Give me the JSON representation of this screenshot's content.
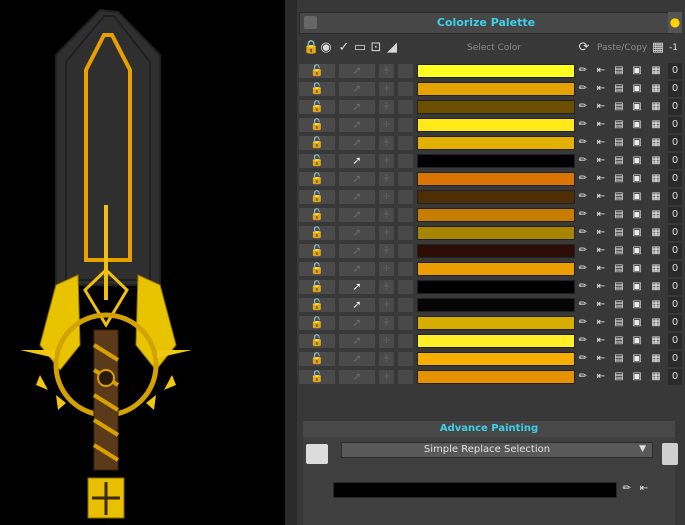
{
  "panel": {
    "title": "Colorize Palette",
    "header": {
      "select_color_label": "Select Color",
      "paste_copy_label": "Paste/Copy",
      "header_number": "-1"
    },
    "rows": [
      {
        "color": "#ffff22",
        "brush_active": false,
        "value": "0"
      },
      {
        "color": "#e4a300",
        "brush_active": false,
        "value": "0"
      },
      {
        "color": "#6b4e00",
        "brush_active": false,
        "value": "0"
      },
      {
        "color": "#ffe918",
        "brush_active": false,
        "value": "0"
      },
      {
        "color": "#e3b000",
        "brush_active": false,
        "value": "0"
      },
      {
        "color": "#000000",
        "brush_active": true,
        "value": "0"
      },
      {
        "color": "#d97500",
        "brush_active": false,
        "value": "0"
      },
      {
        "color": "#4d2e05",
        "brush_active": false,
        "value": "0"
      },
      {
        "color": "#c87d00",
        "brush_active": false,
        "value": "0"
      },
      {
        "color": "#a98400",
        "brush_active": false,
        "value": "0"
      },
      {
        "color": "#2c0d05",
        "brush_active": false,
        "value": "0"
      },
      {
        "color": "#ec9e00",
        "brush_active": false,
        "value": "0"
      },
      {
        "color": "#000000",
        "brush_active": true,
        "value": "0"
      },
      {
        "color": "#050505",
        "brush_active": true,
        "value": "0"
      },
      {
        "color": "#d7ad00",
        "brush_active": false,
        "value": "0"
      },
      {
        "color": "#ffee28",
        "brush_active": false,
        "value": "0"
      },
      {
        "color": "#f6ae00",
        "brush_active": false,
        "value": "0"
      },
      {
        "color": "#e69200",
        "brush_active": false,
        "value": "0"
      }
    ]
  },
  "advance_painting": {
    "title": "Advance Painting",
    "mode_selected": "Simple Replace Selection",
    "bottom_color": "#000000"
  },
  "icons": {
    "lock": "lock-icon",
    "brush": "paintbrush-icon",
    "eyedropper": "eyedropper-icon",
    "arrow": "arrow-left-bar-icon",
    "clipboard": "clipboard-icon",
    "copy": "copy-icon",
    "transparency": "transparency-icon"
  }
}
